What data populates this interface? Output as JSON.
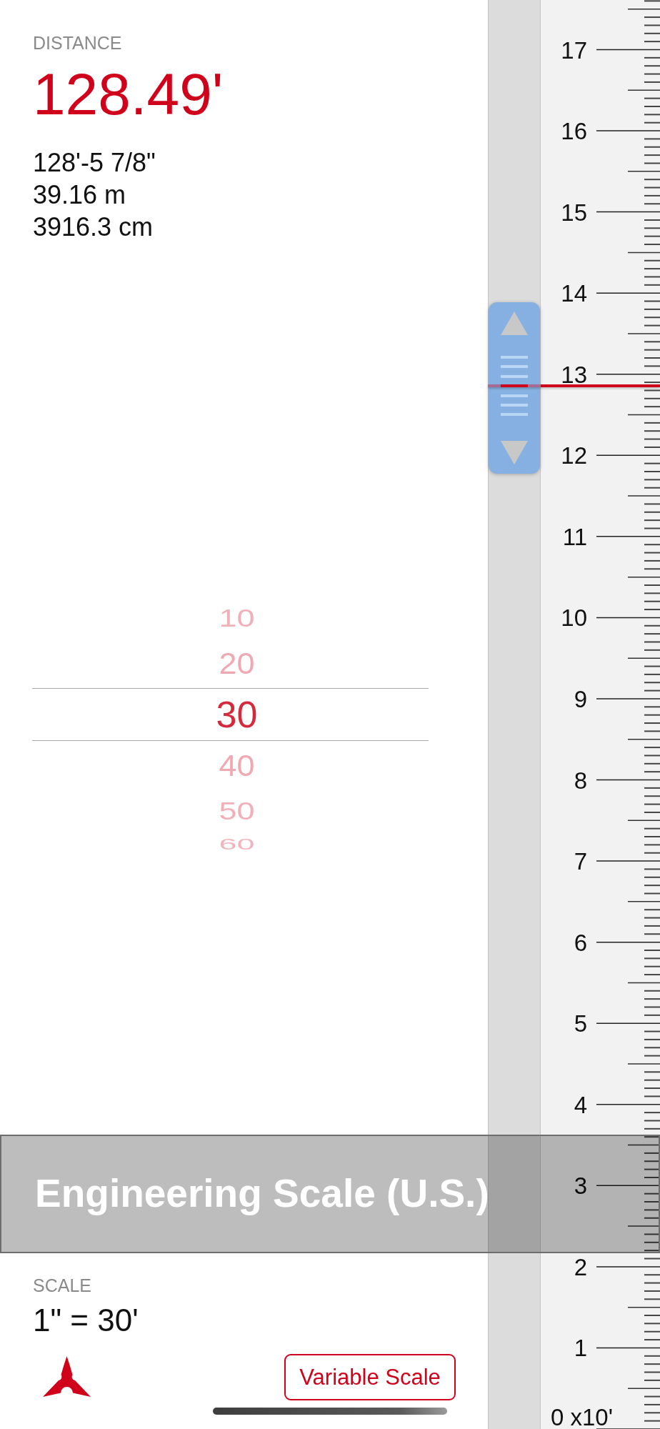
{
  "distance": {
    "label": "DISTANCE",
    "value": "128.49'",
    "conversions": [
      "128'-5 7/8\"",
      "39.16 m",
      "3916.3 cm"
    ]
  },
  "scale_picker": {
    "items": [
      {
        "label": "10",
        "selected": false
      },
      {
        "label": "20",
        "selected": false
      },
      {
        "label": "30",
        "selected": true
      },
      {
        "label": "40",
        "selected": false
      },
      {
        "label": "50",
        "selected": false
      },
      {
        "label": "60",
        "selected": false
      }
    ]
  },
  "banner": {
    "title": "Engineering Scale (U.S.)"
  },
  "scale": {
    "label": "SCALE",
    "value": "1\" = 30'"
  },
  "variable_scale_button": {
    "label": "Variable Scale"
  },
  "slider": {
    "level": 0.73
  },
  "ruler": {
    "labels": [
      "17",
      "16",
      "15",
      "14",
      "13",
      "12",
      "11",
      "10",
      "9",
      "8",
      "7",
      "6",
      "5",
      "4",
      "3",
      "2",
      "1",
      "0 x10'"
    ]
  }
}
